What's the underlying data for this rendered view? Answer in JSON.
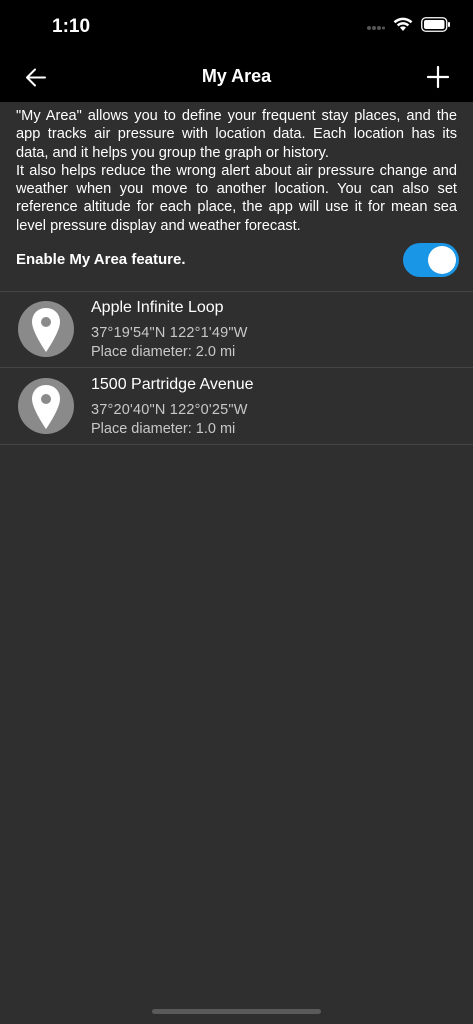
{
  "status_bar": {
    "time": "1:10"
  },
  "nav": {
    "title": "My Area",
    "back_icon": "arrow-left-icon",
    "add_icon": "plus-icon"
  },
  "description": {
    "paragraph1": "\"My Area\" allows you to define your frequent stay places, and the app tracks air pressure with location data. Each location has its data, and it helps you group the graph or history.",
    "paragraph2": "It also helps reduce the wrong alert about air pressure change and weather when you move to another location. You can also set reference altitude for each place, the app will use it for mean sea level pressure display and weather forecast."
  },
  "enable": {
    "label": "Enable My Area feature.",
    "enabled": true
  },
  "places": [
    {
      "name": "Apple Infinite Loop",
      "coords": "37°19'54\"N 122°1'49\"W",
      "diameter": "Place diameter: 2.0 mi"
    },
    {
      "name": "1500 Partridge Avenue",
      "coords": "37°20'40\"N 122°0'25\"W",
      "diameter": "Place diameter: 1.0 mi"
    }
  ],
  "colors": {
    "accent": "#1a96e6",
    "background": "#2f2f2f",
    "bar": "#000000",
    "pin": "#8a8a8a"
  }
}
